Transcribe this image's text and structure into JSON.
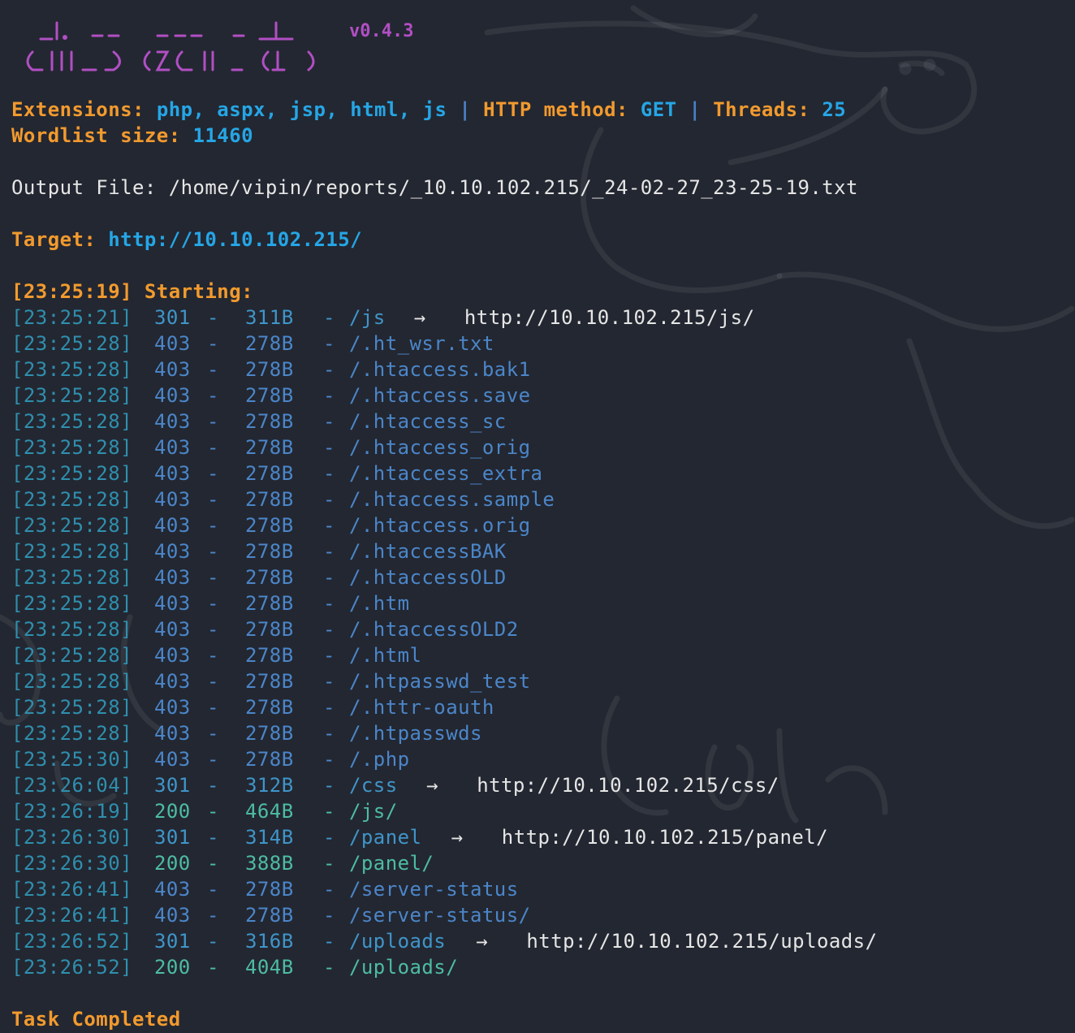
{
  "header": {
    "version": "v0.4.3",
    "extensions_label": "Extensions:",
    "extensions_value": "php, aspx, jsp, html, js",
    "separator": "|",
    "method_label": "HTTP method:",
    "method_value": "GET",
    "threads_label": "Threads:",
    "threads_value": "25",
    "wordlist_label": "Wordlist size:",
    "wordlist_value": "11460",
    "output_label": "Output File:",
    "output_value": "/home/vipin/reports/_10.10.102.215/_24-02-27_23-25-19.txt",
    "target_label": "Target:",
    "target_value": "http://10.10.102.215/",
    "starting_time": "[23:25:19]",
    "starting_label": "Starting:"
  },
  "results": [
    {
      "time": "[23:25:21]",
      "status": "301",
      "size": "311B",
      "path": "/js",
      "redirect": "http://10.10.102.215/js/"
    },
    {
      "time": "[23:25:28]",
      "status": "403",
      "size": "278B",
      "path": "/.ht_wsr.txt",
      "redirect": ""
    },
    {
      "time": "[23:25:28]",
      "status": "403",
      "size": "278B",
      "path": "/.htaccess.bak1",
      "redirect": ""
    },
    {
      "time": "[23:25:28]",
      "status": "403",
      "size": "278B",
      "path": "/.htaccess.save",
      "redirect": ""
    },
    {
      "time": "[23:25:28]",
      "status": "403",
      "size": "278B",
      "path": "/.htaccess_sc",
      "redirect": ""
    },
    {
      "time": "[23:25:28]",
      "status": "403",
      "size": "278B",
      "path": "/.htaccess_orig",
      "redirect": ""
    },
    {
      "time": "[23:25:28]",
      "status": "403",
      "size": "278B",
      "path": "/.htaccess_extra",
      "redirect": ""
    },
    {
      "time": "[23:25:28]",
      "status": "403",
      "size": "278B",
      "path": "/.htaccess.sample",
      "redirect": ""
    },
    {
      "time": "[23:25:28]",
      "status": "403",
      "size": "278B",
      "path": "/.htaccess.orig",
      "redirect": ""
    },
    {
      "time": "[23:25:28]",
      "status": "403",
      "size": "278B",
      "path": "/.htaccessBAK",
      "redirect": ""
    },
    {
      "time": "[23:25:28]",
      "status": "403",
      "size": "278B",
      "path": "/.htaccessOLD",
      "redirect": ""
    },
    {
      "time": "[23:25:28]",
      "status": "403",
      "size": "278B",
      "path": "/.htm",
      "redirect": ""
    },
    {
      "time": "[23:25:28]",
      "status": "403",
      "size": "278B",
      "path": "/.htaccessOLD2",
      "redirect": ""
    },
    {
      "time": "[23:25:28]",
      "status": "403",
      "size": "278B",
      "path": "/.html",
      "redirect": ""
    },
    {
      "time": "[23:25:28]",
      "status": "403",
      "size": "278B",
      "path": "/.htpasswd_test",
      "redirect": ""
    },
    {
      "time": "[23:25:28]",
      "status": "403",
      "size": "278B",
      "path": "/.httr-oauth",
      "redirect": ""
    },
    {
      "time": "[23:25:28]",
      "status": "403",
      "size": "278B",
      "path": "/.htpasswds",
      "redirect": ""
    },
    {
      "time": "[23:25:30]",
      "status": "403",
      "size": "278B",
      "path": "/.php",
      "redirect": ""
    },
    {
      "time": "[23:26:04]",
      "status": "301",
      "size": "312B",
      "path": "/css",
      "redirect": "http://10.10.102.215/css/"
    },
    {
      "time": "[23:26:19]",
      "status": "200",
      "size": "464B",
      "path": "/js/",
      "redirect": ""
    },
    {
      "time": "[23:26:30]",
      "status": "301",
      "size": "314B",
      "path": "/panel",
      "redirect": "http://10.10.102.215/panel/"
    },
    {
      "time": "[23:26:30]",
      "status": "200",
      "size": "388B",
      "path": "/panel/",
      "redirect": ""
    },
    {
      "time": "[23:26:41]",
      "status": "403",
      "size": "278B",
      "path": "/server-status",
      "redirect": ""
    },
    {
      "time": "[23:26:41]",
      "status": "403",
      "size": "278B",
      "path": "/server-status/",
      "redirect": ""
    },
    {
      "time": "[23:26:52]",
      "status": "301",
      "size": "316B",
      "path": "/uploads",
      "redirect": "http://10.10.102.215/uploads/"
    },
    {
      "time": "[23:26:52]",
      "status": "200",
      "size": "404B",
      "path": "/uploads/",
      "redirect": ""
    }
  ],
  "dash": "-",
  "arrow": "→",
  "footer": {
    "completed": "Task Completed"
  },
  "colors": {
    "background": "#232731",
    "orange": "#f29a2e",
    "blue": "#25a6e6",
    "purple": "#b14fc4",
    "status_301": "#3f95c9",
    "status_200": "#4dbca3",
    "status_403": "#4b86c9"
  }
}
